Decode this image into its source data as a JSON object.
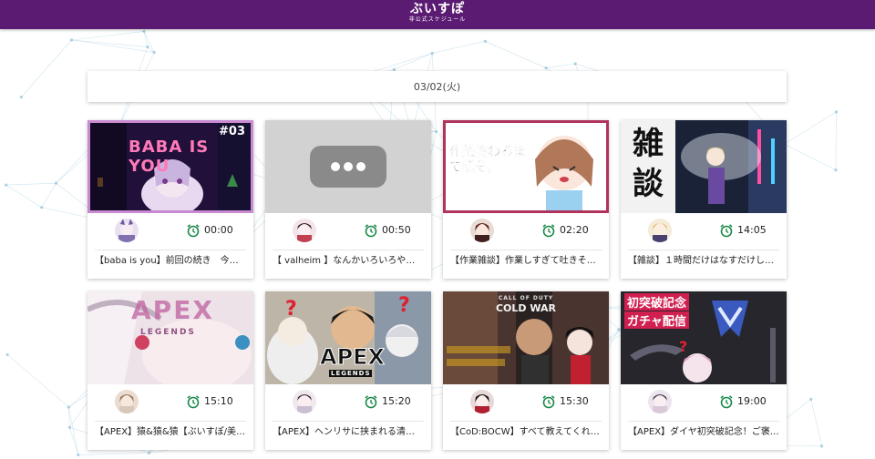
{
  "header": {
    "logo_main": "ぶいすぽ",
    "logo_sub": "非公式スケジュール"
  },
  "date_label": "03/02(火)",
  "colors": {
    "header_bg": "#5b1b72",
    "clock_icon": "#1a8a4a",
    "live_border": "#c88ad0"
  },
  "cards": [
    {
      "time": "00:00",
      "title": "【baba is you】前回の続き　今日…",
      "thumb_text": "BABA IS YOU",
      "thumb_badge": "#03",
      "avatar_icon": "avatar-icon",
      "live": true
    },
    {
      "time": "00:50",
      "title": "【 valheim 】なんかいろいろやる…",
      "thumb_icon": "more-horizontal-icon",
      "avatar_icon": "avatar-icon",
      "live": false
    },
    {
      "time": "02:20",
      "title": "【作業雑談】作業しすぎて吐きそ…",
      "thumb_text": "作業終わるまで話そ。",
      "avatar_icon": "avatar-icon",
      "live": true
    },
    {
      "time": "14:05",
      "title": "【雑談】１時間だけはなすだけし…",
      "thumb_text": "雑談",
      "avatar_icon": "avatar-icon",
      "live": false
    },
    {
      "time": "15:10",
      "title": "【APEX】猿&猿&猿【ぶいすぽ/美…",
      "thumb_text": "APEX",
      "thumb_sub": "LEGENDS",
      "avatar_icon": "avatar-icon",
      "live": false
    },
    {
      "time": "15:20",
      "title": "【APEX】ヘンリサに挟まれる清楚…",
      "thumb_text": "APEX",
      "thumb_sub": "LEGENDS",
      "avatar_icon": "avatar-icon",
      "live": false
    },
    {
      "time": "15:30",
      "title": "【CoD:BOCW】すべて教えてくれ…",
      "thumb_text": "COLD WAR",
      "thumb_sub": "CALL OF DUTY",
      "avatar_icon": "avatar-icon",
      "live": false
    },
    {
      "time": "19:00",
      "title": "【APEX】ダイヤ初突破記念！ご褒…",
      "thumb_text": "初突破記念",
      "thumb_sub": "ガチャ配信",
      "avatar_icon": "avatar-icon",
      "live": false
    }
  ]
}
